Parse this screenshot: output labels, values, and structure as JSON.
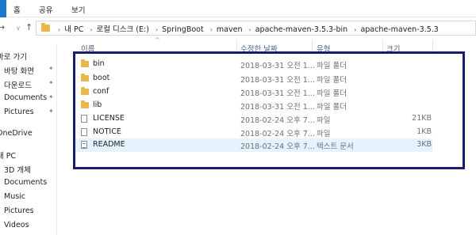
{
  "ribbon": {
    "tabs": [
      "홈",
      "공유",
      "보기"
    ]
  },
  "nav": {
    "back_icon": "back-arrow-icon",
    "forward_icon": "forward-arrow-icon",
    "recent_icon": "chevron-down-icon",
    "up_icon": "up-arrow-icon"
  },
  "address": {
    "crumbs": [
      "내 PC",
      "로컬 디스크 (E:)",
      "SpringBoot",
      "maven",
      "apache-maven-3.5.3-bin",
      "apache-maven-3.5.3"
    ]
  },
  "sidebar": {
    "items": [
      {
        "label": "바로 가기",
        "pinned": false
      },
      {
        "label": "바탕 화면",
        "pinned": true
      },
      {
        "label": "다운로드",
        "pinned": true
      },
      {
        "label": "Documents",
        "pinned": true
      },
      {
        "label": "Pictures",
        "pinned": true
      },
      {
        "label": "OneDrive",
        "pinned": false
      },
      {
        "label": "내 PC",
        "pinned": false
      },
      {
        "label": "3D 개체",
        "pinned": false
      },
      {
        "label": "Documents",
        "pinned": false
      },
      {
        "label": "Music",
        "pinned": false
      },
      {
        "label": "Pictures",
        "pinned": false
      },
      {
        "label": "Videos",
        "pinned": false
      }
    ]
  },
  "columns": {
    "name": "이름",
    "date": "수정한 날짜",
    "type": "유형",
    "size": "크기"
  },
  "files": [
    {
      "name": "bin",
      "date": "2018-03-31 오전 1...",
      "type": "파일 폴더",
      "size": "",
      "icon": "folder"
    },
    {
      "name": "boot",
      "date": "2018-03-31 오전 1...",
      "type": "파일 폴더",
      "size": "",
      "icon": "folder"
    },
    {
      "name": "conf",
      "date": "2018-03-31 오전 1...",
      "type": "파일 폴더",
      "size": "",
      "icon": "folder"
    },
    {
      "name": "lib",
      "date": "2018-03-31 오전 1...",
      "type": "파일 폴더",
      "size": "",
      "icon": "folder"
    },
    {
      "name": "LICENSE",
      "date": "2018-02-24 오후 7...",
      "type": "파일",
      "size": "21KB",
      "icon": "file"
    },
    {
      "name": "NOTICE",
      "date": "2018-02-24 오후 7...",
      "type": "파일",
      "size": "1KB",
      "icon": "file"
    },
    {
      "name": "README",
      "date": "2018-02-24 오후 7...",
      "type": "텍스트 문서",
      "size": "3KB",
      "icon": "text",
      "selected": true
    }
  ]
}
